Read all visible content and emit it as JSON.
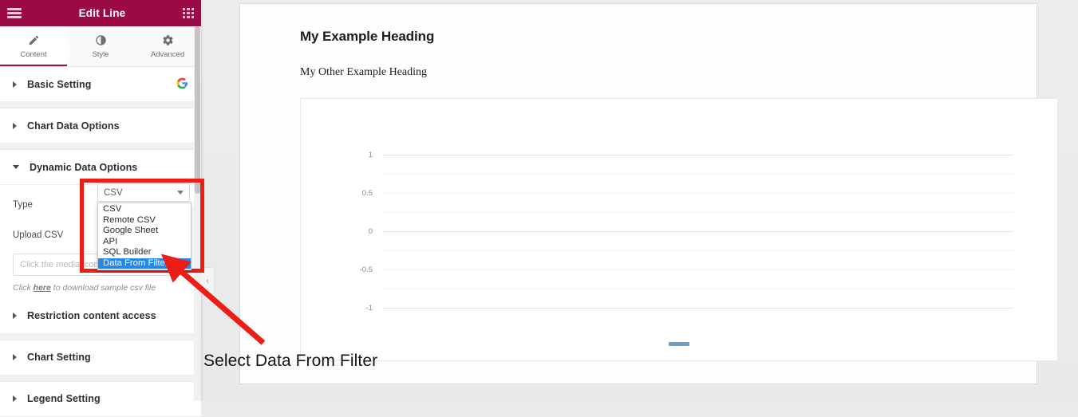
{
  "panel": {
    "title": "Edit Line",
    "menu_icon": "hamburger-icon",
    "apps_icon": "grid-apps-icon",
    "tabs": [
      {
        "label": "Content",
        "icon": "pencil-icon",
        "active": true
      },
      {
        "label": "Style",
        "icon": "contrast-circle-icon",
        "active": false
      },
      {
        "label": "Advanced",
        "icon": "gear-icon",
        "active": false
      }
    ],
    "sections": [
      {
        "label": "Basic Setting",
        "expanded": false,
        "badge": "google-g-icon"
      },
      {
        "label": "Chart Data Options",
        "expanded": false
      },
      {
        "label": "Dynamic Data Options",
        "expanded": true
      },
      {
        "label": "Restriction content access",
        "expanded": false
      },
      {
        "label": "Chart Setting",
        "expanded": false
      },
      {
        "label": "Legend Setting",
        "expanded": false
      }
    ],
    "dynamic_data": {
      "type_label": "Type",
      "type_value": "CSV",
      "type_options": [
        "CSV",
        "Remote CSV",
        "Google Sheet",
        "API",
        "SQL Builder",
        "Data From Filter"
      ],
      "type_selected_option": "Data From Filter",
      "upload_label": "Upload CSV",
      "upload_placeholder": "Click the media icon t",
      "hint_before": "Click ",
      "hint_link": "here",
      "hint_after": " to download sample csv file"
    },
    "collapse_handle": "‹"
  },
  "canvas": {
    "heading1": "My Example Heading",
    "heading2": "My Other Example Heading",
    "chart_data": {
      "type": "line",
      "title": "",
      "xlabel": "",
      "ylabel": "",
      "categories": [],
      "series": [
        {
          "name": "",
          "values": []
        }
      ],
      "yticks": [
        "1",
        "0.5",
        "0",
        "-0.5",
        "-1"
      ],
      "ylim": [
        -1,
        1
      ],
      "grid": true,
      "legend_position": "bottom",
      "legend_swatch_color": "#6f9fc0"
    }
  },
  "annotation": {
    "text": "Select Data From Filter",
    "arrow_color": "#ec1c16",
    "highlight_box_color": "#ec1c16",
    "highlight_option_color": "#2488ea"
  }
}
